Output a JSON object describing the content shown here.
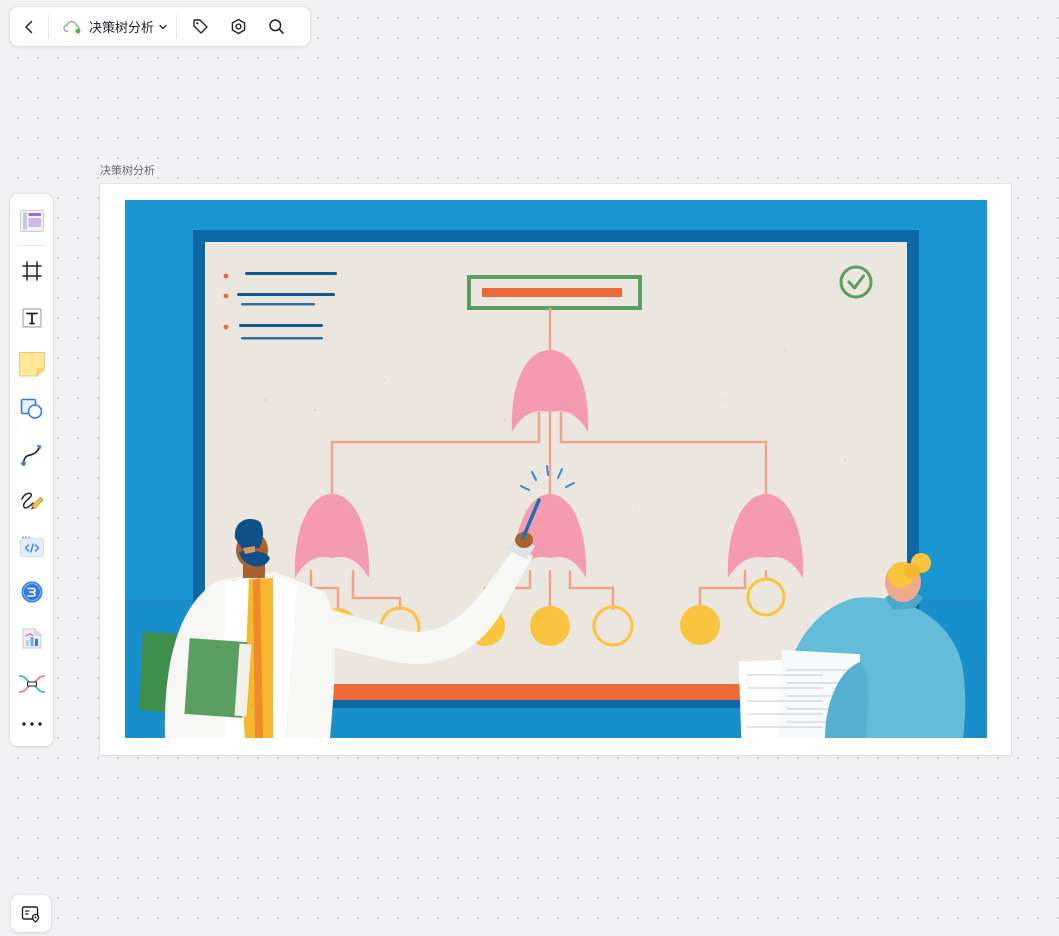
{
  "toolbar": {
    "doc_title": "决策树分析",
    "icons": [
      "back-arrow-icon",
      "cloud-sync-icon",
      "chevron-down-icon",
      "tag-icon",
      "gear-icon",
      "search-icon"
    ]
  },
  "left_toolbar": {
    "tools": [
      "template-icon",
      "frame-tool-icon",
      "text-tool-icon",
      "sticky-note-icon",
      "shape-tool-icon",
      "connector-tool-icon",
      "pen-tool-icon",
      "code-block-icon",
      "mindmap-icon",
      "chart-tool-icon",
      "flowchart-icon",
      "more-icon"
    ]
  },
  "canvas": {
    "frame_title": "决策树分析"
  },
  "bottom": {
    "icon": "minimap-icon"
  },
  "colors": {
    "background": "#f2f2f4",
    "illustration_sky": "#1a96d2",
    "board": "#ece7de",
    "tree_pink": "#f59bb0",
    "leaf_yellow": "#fbc43f",
    "title_box_green": "#5a9e62",
    "accent_orange": "#ef6a3a",
    "cloud_green": "#34c724"
  }
}
